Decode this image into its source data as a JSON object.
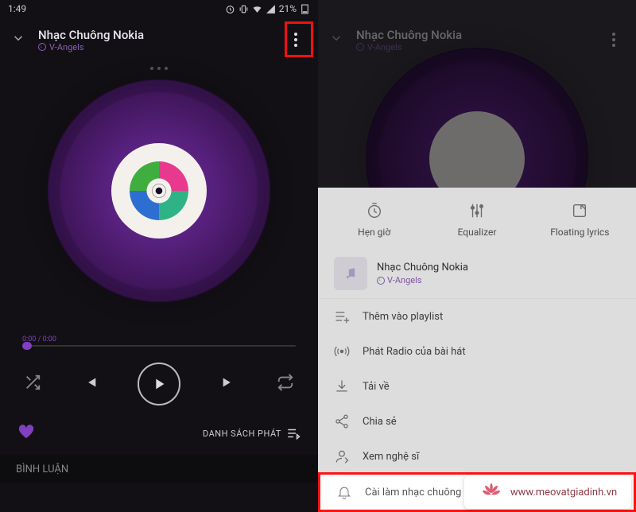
{
  "statusbar": {
    "time": "1:49",
    "battery": "21%"
  },
  "player": {
    "title": "Nhạc Chuông Nokia",
    "artist": "V-Angels",
    "time": "0:00 / 0:00",
    "queue_label": "DANH SÁCH PHÁT"
  },
  "comments_tab": "BÌNH LUẬN",
  "sheet": {
    "timer": "Hẹn giờ",
    "equalizer": "Equalizer",
    "lyrics": "Floating lyrics",
    "song_title": "Nhạc Chuông Nokia",
    "song_artist": "V-Angels",
    "menu": {
      "add_playlist": "Thêm vào playlist",
      "play_radio": "Phát Radio của bài hát",
      "download": "Tải về",
      "share": "Chia sẻ",
      "view_artist": "Xem nghệ sĩ",
      "set_ringtone": "Cài làm nhạc chuông"
    }
  },
  "watermark": "www.meovatgiadinh.vn"
}
